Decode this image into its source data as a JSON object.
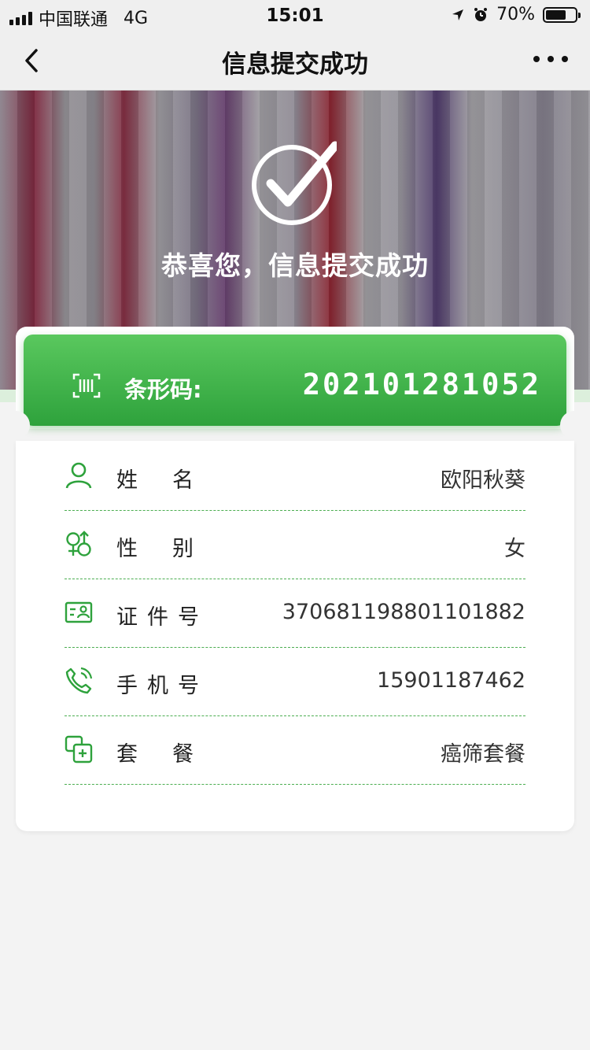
{
  "status_bar": {
    "carrier": "中国联通",
    "network": "4G",
    "time": "15:01",
    "battery": "70%",
    "battery_level": 0.7
  },
  "nav": {
    "title": "信息提交成功"
  },
  "hero": {
    "message": "恭喜您，信息提交成功"
  },
  "barcode": {
    "label": "条形码:",
    "value": "202101281052"
  },
  "rows": [
    {
      "label": "姓名",
      "value": "欧阳秋葵",
      "icon": "person-icon"
    },
    {
      "label": "性别",
      "value": "女",
      "icon": "gender-icon"
    },
    {
      "label": "证件号",
      "value": "370681198801101882",
      "icon": "id-card-icon"
    },
    {
      "label": "手机号",
      "value": "15901187462",
      "icon": "phone-icon"
    },
    {
      "label": "套餐",
      "value": "癌筛套餐",
      "icon": "package-icon"
    }
  ],
  "colors": {
    "accent_green": "#2ea23c",
    "divider_green": "#4cae51"
  }
}
